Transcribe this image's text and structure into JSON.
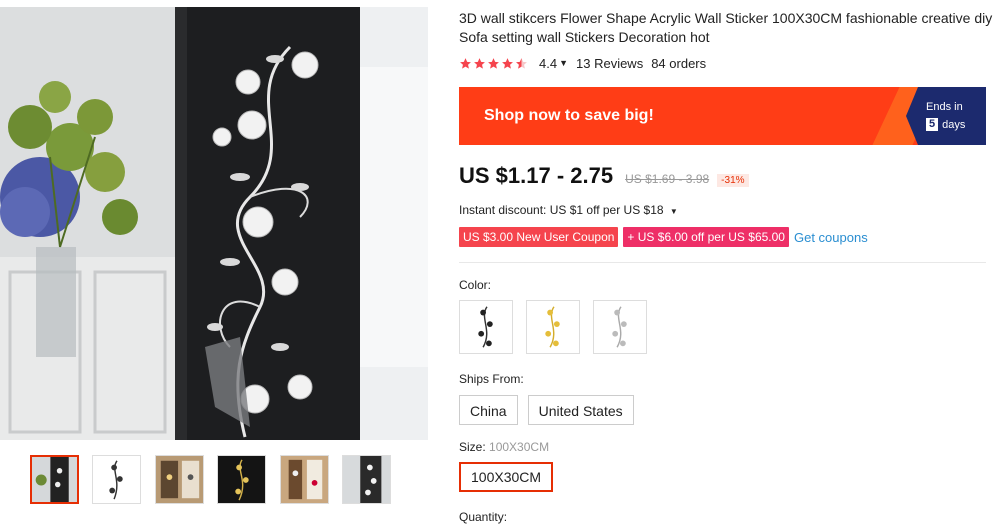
{
  "product": {
    "title": "3D wall stikcers Flower Shape Acrylic Wall Sticker 100X30CM fashionable creative diy Sofa setting wall Stickers Decoration hot"
  },
  "rating": {
    "value": "4.4",
    "reviews": "13 Reviews",
    "orders": "84 orders",
    "stars": 4.4
  },
  "promo": {
    "text": "Shop now to save big!",
    "ends_label": "Ends in",
    "days_value": "5",
    "days_label": "days"
  },
  "price": {
    "current": "US $1.17 - 2.75",
    "original": "US $1.69 - 3.98",
    "discount": "-31%"
  },
  "instant_discount": "Instant discount: US $1 off per US $18",
  "coupons": {
    "new_user": "US $3.00 New User Coupon",
    "store": "+ US $6.00 off per US $65.00",
    "get_link": "Get coupons"
  },
  "color": {
    "label": "Color:",
    "options": [
      "black",
      "gold",
      "silver"
    ]
  },
  "ships_from": {
    "label": "Ships From:",
    "options": [
      "China",
      "United States"
    ]
  },
  "size": {
    "label": "Size:",
    "selected_hint": "100X30CM",
    "options": [
      "100X30CM"
    ]
  },
  "quantity": {
    "label": "Quantity:"
  },
  "colors": {
    "accent": "#e62e04",
    "promo_bg": "#ff3d16",
    "ends_bg": "#1c2a6e",
    "link": "#2a8ed1"
  }
}
